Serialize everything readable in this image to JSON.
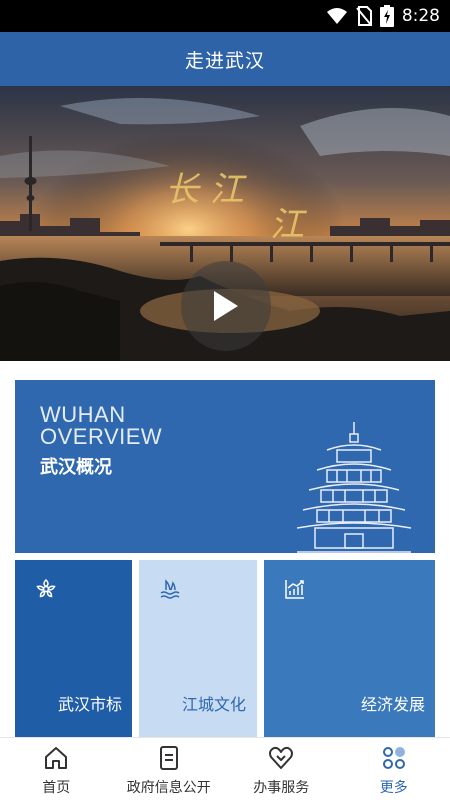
{
  "status": {
    "time": "8:28"
  },
  "header": {
    "title": "走进武汉"
  },
  "hero": {
    "play_icon": "play-icon"
  },
  "overview": {
    "title_en_line1": "WUHAN",
    "title_en_line2": "OVERVIEW",
    "title_cn": "武汉概况"
  },
  "tiles": [
    {
      "label": "武汉市标",
      "icon": "flower-icon"
    },
    {
      "label": "江城文化",
      "icon": "waves-icon"
    },
    {
      "label": "经济发展",
      "icon": "chart-icon"
    }
  ],
  "nav": {
    "items": [
      {
        "label": "首页",
        "icon": "home-icon"
      },
      {
        "label": "政府信息公开",
        "icon": "document-icon"
      },
      {
        "label": "办事服务",
        "icon": "heart-icon"
      },
      {
        "label": "更多",
        "icon": "more-icon"
      }
    ],
    "active_index": 3
  },
  "colors": {
    "primary": "#2f63a8",
    "tile_dark": "#1f5ea6",
    "tile_light": "#c7dcf3",
    "tile_mid": "#3a79bb"
  }
}
